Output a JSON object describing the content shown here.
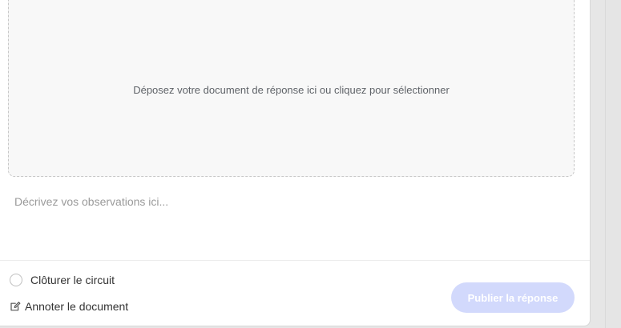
{
  "dropzone": {
    "label": "Déposez votre document de réponse ici ou cliquez pour sélectionner"
  },
  "observations": {
    "placeholder": "Décrivez vos observations ici..."
  },
  "options": {
    "close_circuit_label": "Clôturer le circuit",
    "annotate_label": "Annoter le document",
    "annotate_icon": "edit-icon"
  },
  "actions": {
    "publish_label": "Publier la réponse",
    "publish_color": "#d2d9fc"
  }
}
